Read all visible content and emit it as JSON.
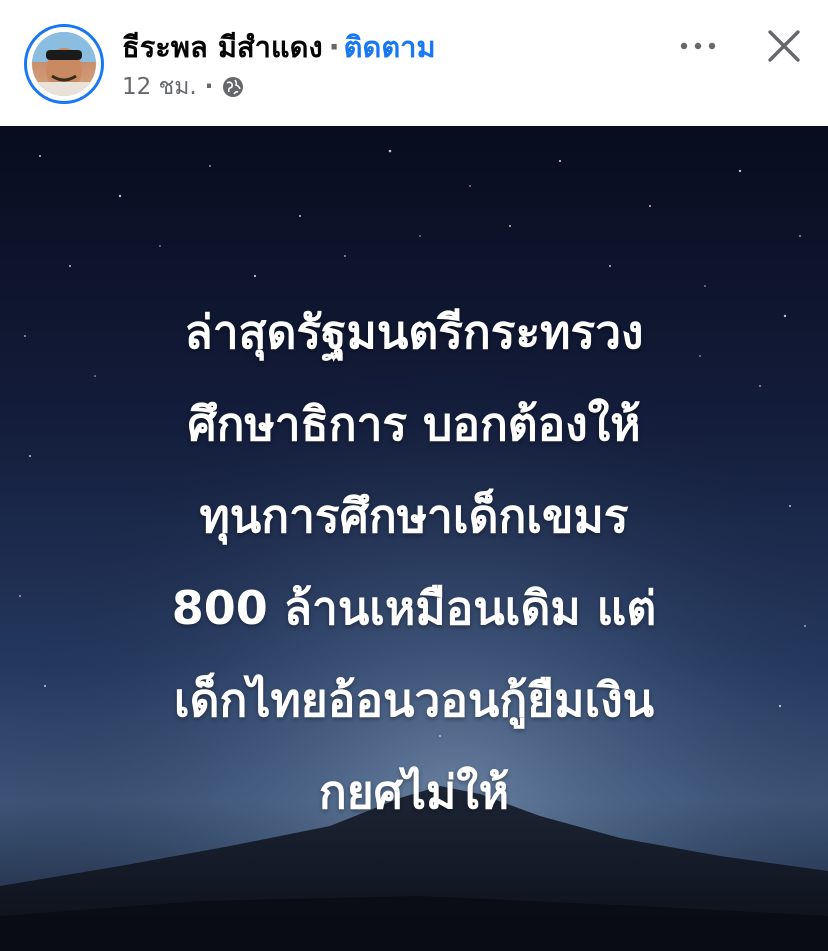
{
  "post": {
    "author": {
      "name": "ธีระพล มีสำแดง",
      "separator": "·",
      "follow_label": "ติดตาม"
    },
    "meta": {
      "time": "12 ชม.",
      "separator": "·",
      "audience_icon": "globe-icon"
    },
    "actions": {
      "more_icon": "more-horizontal-icon",
      "close_icon": "close-icon"
    },
    "image_text": {
      "lines": [
        "ล่าสุดรัฐมนตรีกระทรวง",
        "ศึกษาธิการ บอกต้องให้",
        "ทุนการศึกษาเด็กเขมร",
        "800 ล้านเหมือนเดิม แต่",
        "เด็กไทยอ้อนวอนกู้ยืมเงิน",
        "กยศไม่ให้"
      ]
    }
  },
  "colors": {
    "accent": "#1877f2",
    "secondary_text": "#65676b",
    "primary_text": "#050505",
    "image_text": "#ffffff"
  }
}
